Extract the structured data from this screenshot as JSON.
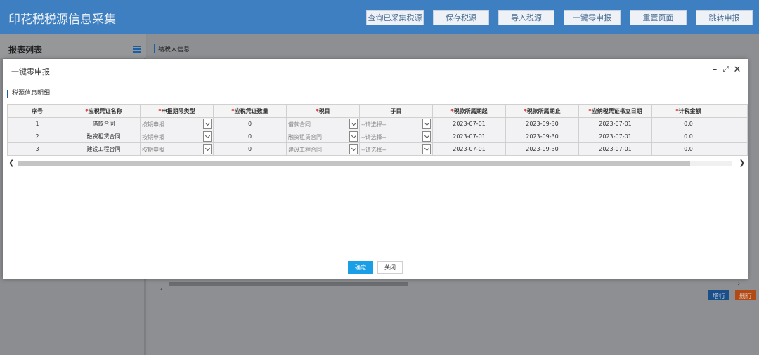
{
  "header": {
    "title": "印花税税源信息采集",
    "buttons": [
      "查询已采集税源",
      "保存税源",
      "导入税源",
      "一键零申报",
      "重置页面",
      "跳转申报"
    ]
  },
  "left_panel": {
    "title": "报表列表",
    "icon": "list-icon"
  },
  "main": {
    "section_title": "纳税人信息",
    "add_row": "增行",
    "delete_row": "删行"
  },
  "modal": {
    "title": "一键零申报",
    "section_title": "税源信息明细",
    "columns": [
      "序号",
      "应税凭证名称",
      "申报期限类型",
      "应税凭证数量",
      "税目",
      "子目",
      "税款所属期起",
      "税款所属期止",
      "应纳税凭证书立日期",
      "计税金额"
    ],
    "required_columns": [
      false,
      true,
      true,
      true,
      true,
      false,
      true,
      true,
      true,
      true
    ],
    "rows": [
      {
        "no": "1",
        "name": "借款合同",
        "period_type": "按期申报",
        "qty": "0",
        "item": "借款合同",
        "sub": "--请选择--",
        "start": "2023-07-01",
        "end": "2023-09-30",
        "date": "2023-07-01",
        "amount": "0.0"
      },
      {
        "no": "2",
        "name": "融资租赁合同",
        "period_type": "按期申报",
        "qty": "0",
        "item": "融资租赁合同",
        "sub": "--请选择--",
        "start": "2023-07-01",
        "end": "2023-09-30",
        "date": "2023-07-01",
        "amount": "0.0"
      },
      {
        "no": "3",
        "name": "建设工程合同",
        "period_type": "按期申报",
        "qty": "0",
        "item": "建设工程合同",
        "sub": "--请选择--",
        "start": "2023-07-01",
        "end": "2023-09-30",
        "date": "2023-07-01",
        "amount": "0.0"
      }
    ],
    "ok_label": "确定",
    "close_label": "关闭"
  },
  "colors": {
    "header_blue": "#3d7fc0",
    "primary": "#1a9fe6",
    "add": "#1b4f8a",
    "delete": "#b14a14"
  }
}
